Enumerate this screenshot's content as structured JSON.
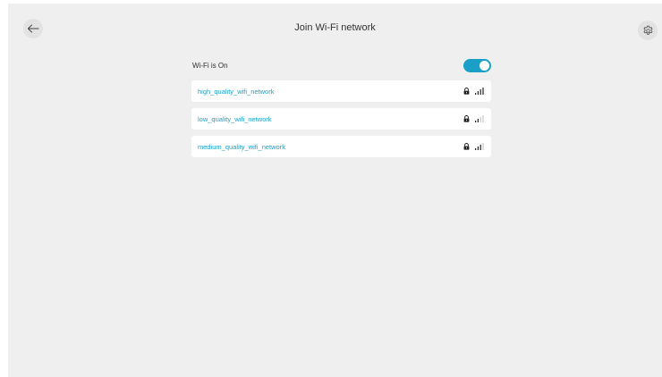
{
  "header": {
    "title": "Join Wi-Fi network",
    "back_icon": "arrow-left-icon",
    "settings_icon": "gear-icon"
  },
  "wifi": {
    "label": "Wi-Fi is On",
    "enabled": true,
    "accent_color": "#1aa0c8"
  },
  "networks": [
    {
      "name": "high_quality_wifi_network",
      "secured": true,
      "signal_bars": 4
    },
    {
      "name": "low_quality_wifi_network",
      "secured": true,
      "signal_bars": 2
    },
    {
      "name": "medium_quality_wifi_network",
      "secured": true,
      "signal_bars": 3
    }
  ]
}
